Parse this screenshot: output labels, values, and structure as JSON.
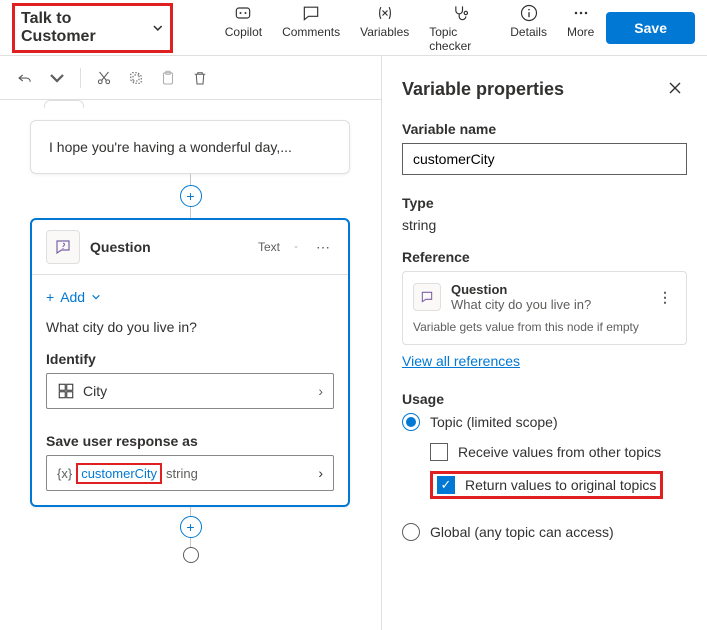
{
  "header": {
    "topic_name": "Talk to Customer",
    "tools": {
      "copilot": "Copilot",
      "comments": "Comments",
      "variables": "Variables",
      "topic_checker": "Topic checker",
      "details": "Details",
      "more": "More"
    },
    "save": "Save"
  },
  "canvas": {
    "message_node_text": "I hope you're having a wonderful day,...",
    "question_node": {
      "title": "Question",
      "response_type": "Text",
      "add_label": "Add",
      "prompt": "What city do you live in?",
      "identify_label": "Identify",
      "identify_value": "City",
      "save_label": "Save user response as",
      "variable_name": "customerCity",
      "variable_type": "string"
    }
  },
  "panel": {
    "title": "Variable properties",
    "var_name_label": "Variable name",
    "var_name_value": "customerCity",
    "type_label": "Type",
    "type_value": "string",
    "reference_label": "Reference",
    "reference": {
      "title": "Question",
      "subtitle": "What city do you live in?",
      "note": "Variable gets value from this node if empty"
    },
    "view_all": "View all references",
    "usage_label": "Usage",
    "usage": {
      "topic": "Topic (limited scope)",
      "receive": "Receive values from other topics",
      "return": "Return values to original topics",
      "global": "Global (any topic can access)"
    }
  }
}
